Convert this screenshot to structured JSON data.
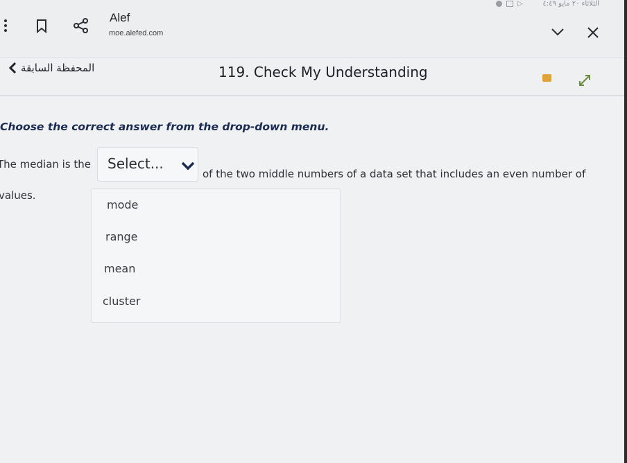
{
  "status_bar": {
    "text": "الثلاثاء ٢٠ مايو ٤:٤٩"
  },
  "browser": {
    "site_title": "Alef",
    "site_url": "moe.alefed.com",
    "icons": [
      "more-vert-icon",
      "bookmark-icon",
      "share-icon",
      "chevron-down-icon",
      "close-icon"
    ]
  },
  "header": {
    "back_label": "المحفظة السابقة",
    "lesson_title": "119. Check My Understanding"
  },
  "question": {
    "instruction": "Choose the correct answer from the drop-down menu.",
    "sentence_start": "The median is the",
    "sentence_end": "of the two middle numbers of a data set that includes an even number of",
    "sentence_wrap": "values.",
    "select": {
      "selected": "Select...",
      "options": [
        "mode",
        "range",
        "mean",
        "cluster"
      ]
    }
  },
  "colors": {
    "instruction": "#1a2a52",
    "badge": "#e0a53a",
    "background": "#eff1f3"
  }
}
